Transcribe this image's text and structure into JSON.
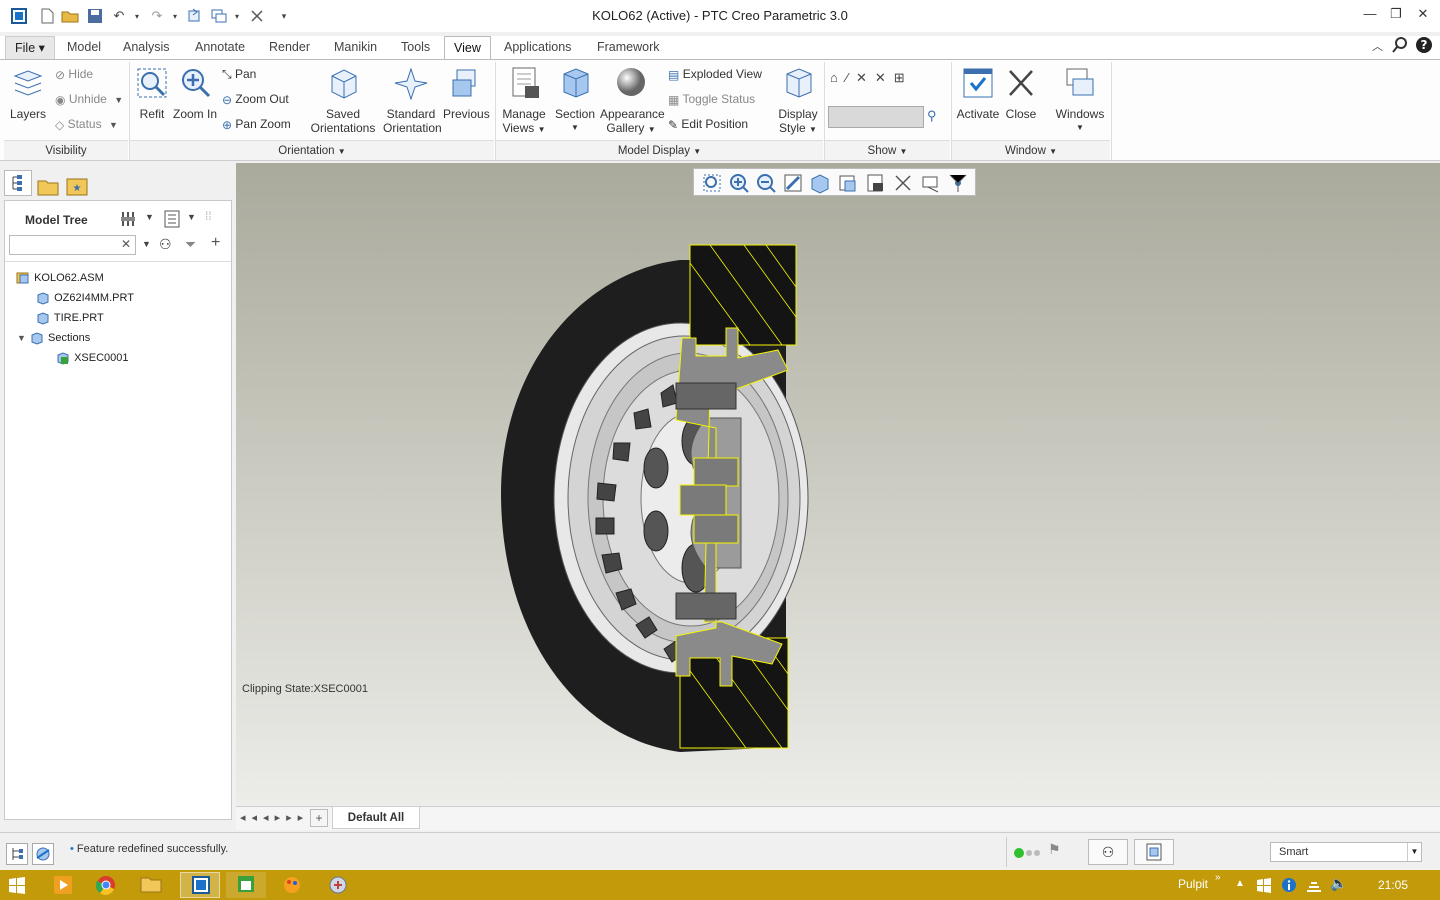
{
  "window": {
    "title": "KOLO62 (Active) - PTC Creo Parametric 3.0"
  },
  "tabs": [
    "File",
    "Model",
    "Analysis",
    "Annotate",
    "Render",
    "Manikin",
    "Tools",
    "View",
    "Applications",
    "Framework"
  ],
  "ribbon": {
    "visibility": {
      "layers": "Layers",
      "hide": "Hide",
      "unhide": "Unhide",
      "status": "Status",
      "group": "Visibility"
    },
    "orientation": {
      "refit": "Refit",
      "zoom_in": "Zoom In",
      "pan": "Pan",
      "zoom_out": "Zoom Out",
      "pan_zoom": "Pan Zoom",
      "saved_1": "Saved",
      "saved_2": "Orientations",
      "standard_1": "Standard",
      "standard_2": "Orientation",
      "previous": "Previous",
      "group": "Orientation"
    },
    "model_display": {
      "manage_1": "Manage",
      "manage_2": "Views",
      "section": "Section",
      "appearance_1": "Appearance",
      "appearance_2": "Gallery",
      "exploded": "Exploded View",
      "toggle": "Toggle Status",
      "edit_position": "Edit Position",
      "display_1": "Display",
      "display_2": "Style",
      "group": "Model Display"
    },
    "show": {
      "group": "Show"
    },
    "window": {
      "activate": "Activate",
      "close": "Close",
      "windows": "Windows",
      "group": "Window"
    }
  },
  "model_tree": {
    "title": "Model Tree",
    "items": [
      {
        "label": "KOLO62.ASM"
      },
      {
        "label": "OZ62I4MM.PRT"
      },
      {
        "label": "TIRE.PRT"
      },
      {
        "label": "Sections"
      },
      {
        "label": "XSEC0001"
      }
    ]
  },
  "viewport": {
    "clipping_state": "Clipping State:XSEC0001"
  },
  "bottom_tabs": {
    "active": "Default All"
  },
  "status": {
    "message": "Feature redefined successfully.",
    "filter": "Smart"
  },
  "taskbar": {
    "desktop": "Pulpit",
    "time": "21:05"
  },
  "colors": {
    "accent": "#1a73c9",
    "taskbar": "#c29a0a",
    "section_edge": "#f5f500"
  }
}
